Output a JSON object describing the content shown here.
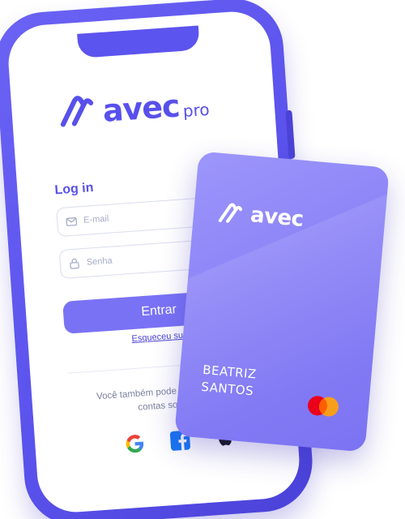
{
  "app": {
    "brand_name": "avec",
    "brand_sub": "pro"
  },
  "login": {
    "title": "Log in",
    "email_placeholder": "E-mail",
    "password_placeholder": "Senha",
    "enter_label": "Entrar",
    "forgot_label": "Esqueceu sua senha?",
    "social_text": "Você também pode entrar com as contas sociais"
  },
  "social": [
    {
      "name": "google-icon"
    },
    {
      "name": "facebook-icon"
    },
    {
      "name": "apple-icon"
    }
  ],
  "card": {
    "brand_name": "avec",
    "holder_name": "BEATRIZ\nSANTOS",
    "network": "mastercard-icon"
  },
  "colors": {
    "brand": "#5850ec",
    "button": "#7a72f5",
    "card": "#8a82f6",
    "phone": "#5a52ec"
  }
}
